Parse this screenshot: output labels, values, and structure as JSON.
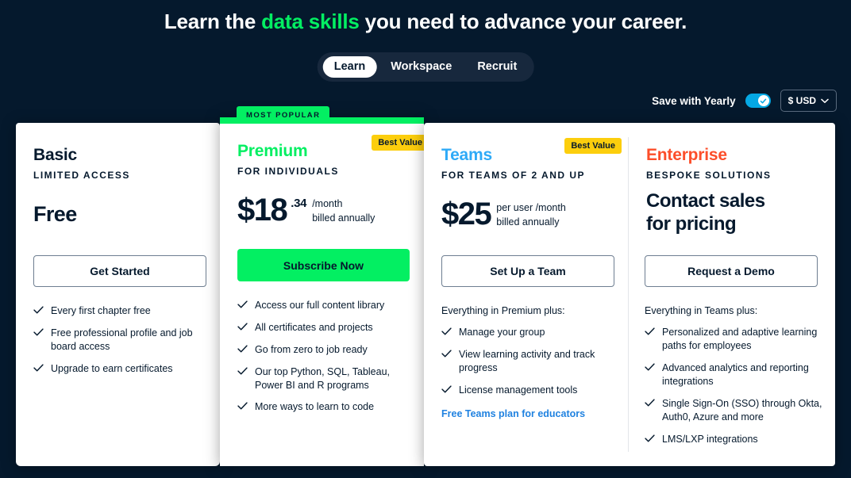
{
  "headline": {
    "before": "Learn the ",
    "highlight": "data skills",
    "after": " you need to advance your career."
  },
  "tabs": [
    {
      "label": "Learn",
      "active": true
    },
    {
      "label": "Workspace",
      "active": false
    },
    {
      "label": "Recruit",
      "active": false
    }
  ],
  "controls": {
    "yearly_label": "Save with Yearly",
    "yearly_on": true,
    "currency": "$ USD"
  },
  "colors": {
    "background": "#05192d",
    "green": "#03ef62",
    "blue": "#2eaaf7",
    "orange": "#fc4e2a",
    "yellow": "#fcce0d",
    "toggle_blue": "#05a8e4",
    "link_blue": "#2082e0"
  },
  "plans": {
    "basic": {
      "name": "Basic",
      "subtitle": "LIMITED ACCESS",
      "price_free": "Free",
      "cta": "Get Started",
      "features": [
        "Every first chapter free",
        "Free professional profile and job board access",
        "Upgrade to earn certificates"
      ]
    },
    "premium": {
      "badge_popular": "MOST POPULAR",
      "badge_value": "Best Value",
      "name": "Premium",
      "subtitle": "FOR INDIVIDUALS",
      "price_main": "$18",
      "price_cents": ".34",
      "price_meta_line1": "/month",
      "price_meta_line2": "billed annually",
      "cta": "Subscribe Now",
      "features": [
        "Access our full content library",
        "All certificates and projects",
        "Go from zero to job ready",
        "Our top Python, SQL, Tableau, Power BI and R programs",
        "More ways to learn to code"
      ]
    },
    "teams": {
      "badge_value": "Best Value",
      "name": "Teams",
      "subtitle": "FOR TEAMS OF 2 AND UP",
      "price_main": "$25",
      "price_meta_line1": "per user /month",
      "price_meta_line2": "billed annually",
      "cta": "Set Up a Team",
      "features_intro": "Everything in Premium plus:",
      "features": [
        "Manage your group",
        "View learning activity and track progress",
        "License management tools"
      ],
      "educators_link": "Free Teams plan for educators"
    },
    "enterprise": {
      "name": "Enterprise",
      "subtitle": "BESPOKE SOLUTIONS",
      "contact_line1": "Contact sales",
      "contact_line2": "for pricing",
      "cta": "Request a Demo",
      "features_intro": "Everything in Teams plus:",
      "features": [
        "Personalized and adaptive learning paths for employees",
        "Advanced analytics and reporting integrations",
        "Single Sign-On (SSO) through Okta, Auth0, Azure and more",
        "LMS/LXP integrations"
      ]
    }
  }
}
